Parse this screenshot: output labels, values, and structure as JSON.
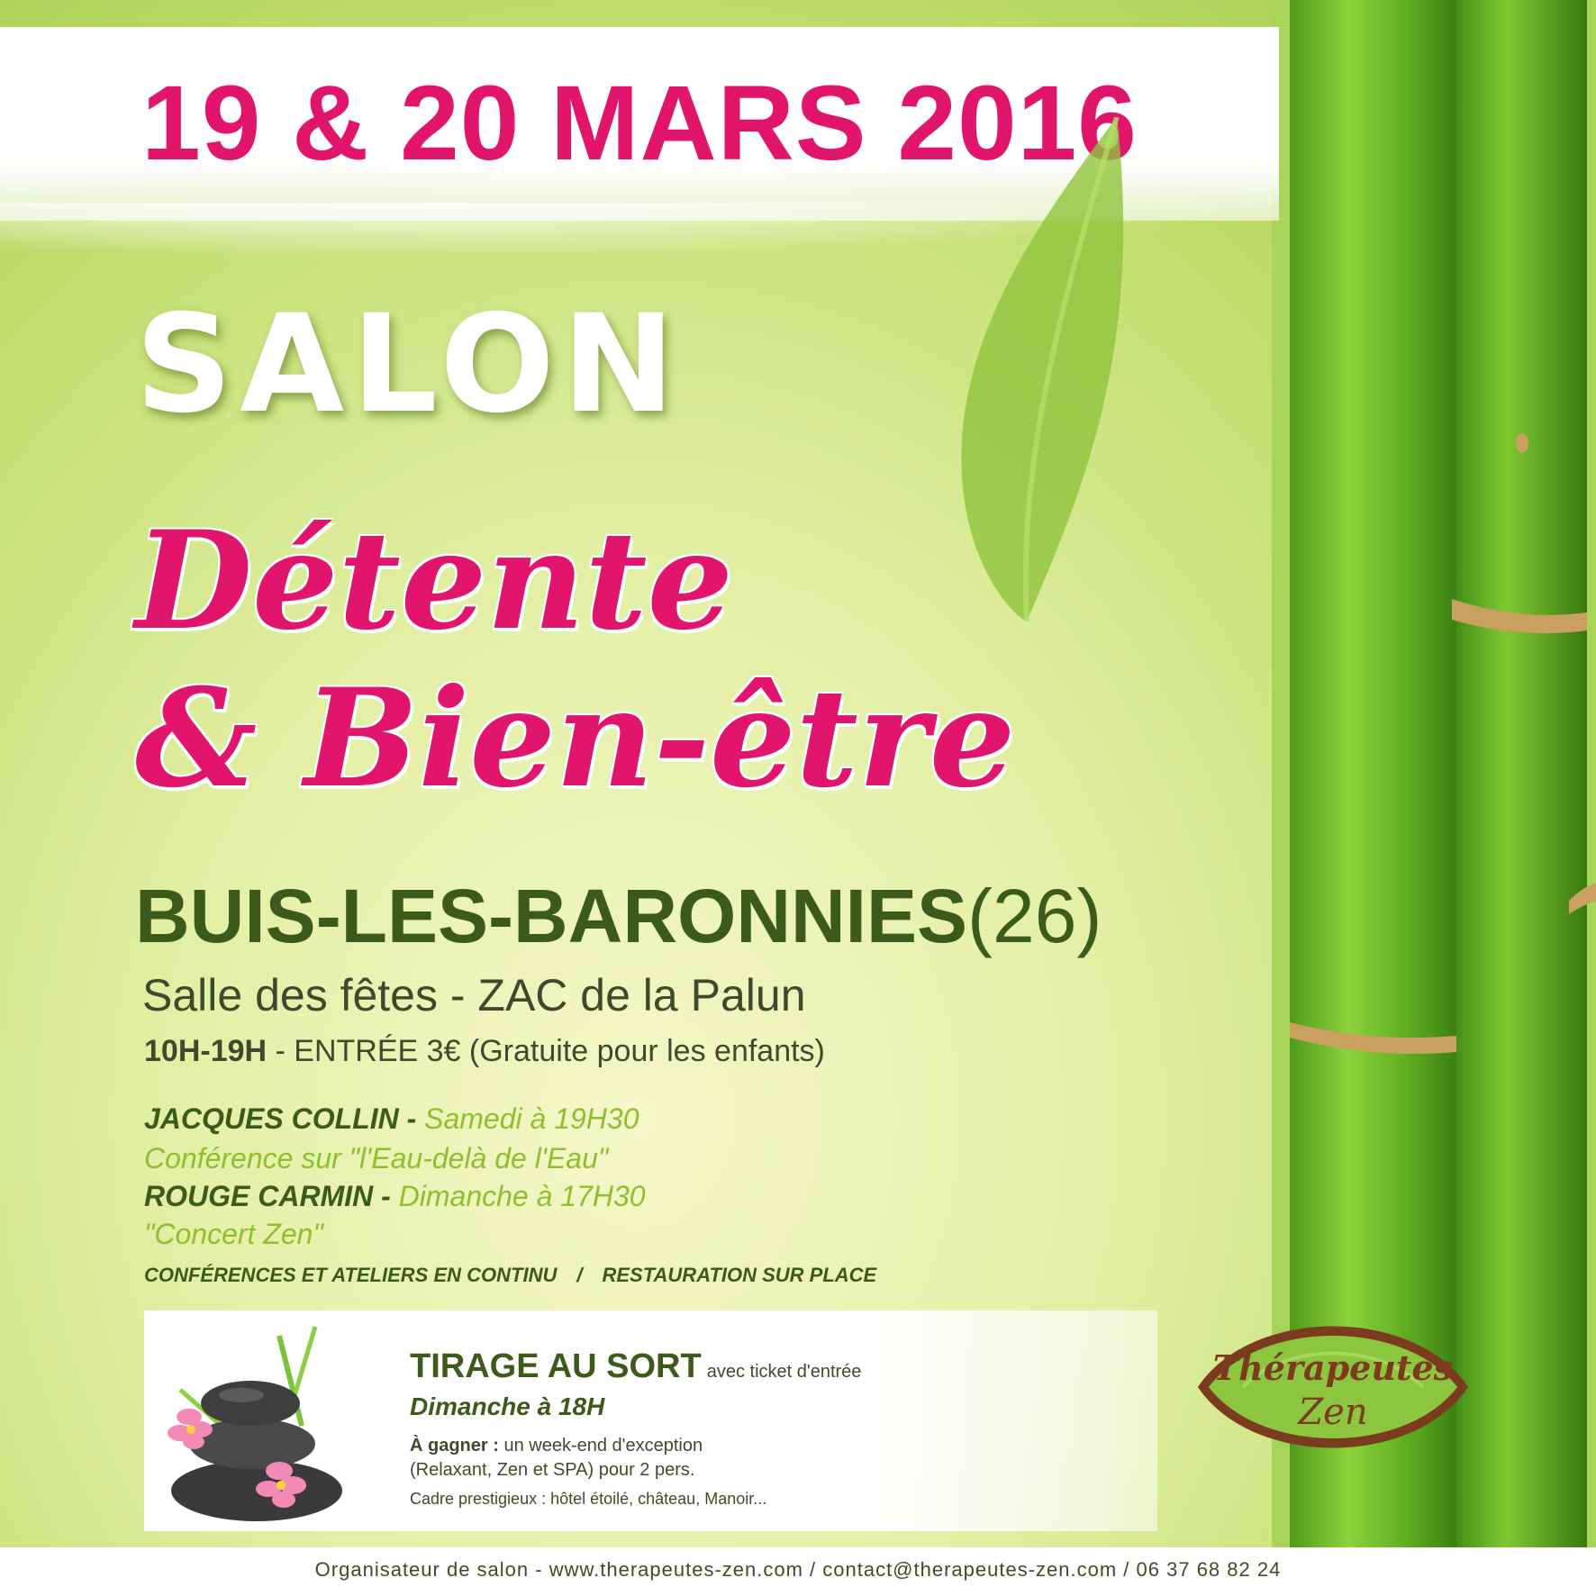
{
  "header": {
    "date": "19 & 20 MARS 2016"
  },
  "title": {
    "salon": "SALON",
    "line1": "Détente",
    "line2": "& Bien-être"
  },
  "location": {
    "city": "BUIS-LES-BARONNIES",
    "department": "(26)",
    "venue": "Salle des fêtes - ZAC de la Palun",
    "hours": "10H-19H",
    "entry": " - ENTRÉE 3€ (Gratuite pour les enfants)"
  },
  "program": [
    {
      "who": "JACQUES COLLIN - ",
      "what": "Samedi à 19H30"
    },
    {
      "who": "",
      "what": "Conférence sur \"l'Eau-delà de l'Eau\""
    },
    {
      "who": "ROUGE CARMIN - ",
      "what": "Dimanche à 17H30"
    },
    {
      "who": "",
      "what": "\"Concert Zen\""
    }
  ],
  "notes": {
    "left": "CONFÉRENCES ET ATELIERS EN CONTINU",
    "separator": "/",
    "right": "RESTAURATION SUR PLACE"
  },
  "tirage": {
    "title": "TIRAGE AU SORT",
    "title_suffix": "avec ticket d'entrée",
    "date": "Dimanche à 18H",
    "win_label": "À gagner :",
    "win_text": " un week-end d'exception",
    "win_text2": "(Relaxant, Zen et SPA) pour 2 pers.",
    "cadre": "Cadre prestigieux : hôtel étoilé, château, Manoir..."
  },
  "logo": {
    "line1": "Thérapeutes",
    "line2": "Zen"
  },
  "organizer": "Organisateur de salon - www.therapeutes-zen.com / contact@therapeutes-zen.com / 06 37 68 82 24",
  "colors": {
    "pink": "#e2156d",
    "dark_green": "#3c5a1a",
    "light_green": "#8fbf2e",
    "logo_brown": "#7a3b1e"
  }
}
